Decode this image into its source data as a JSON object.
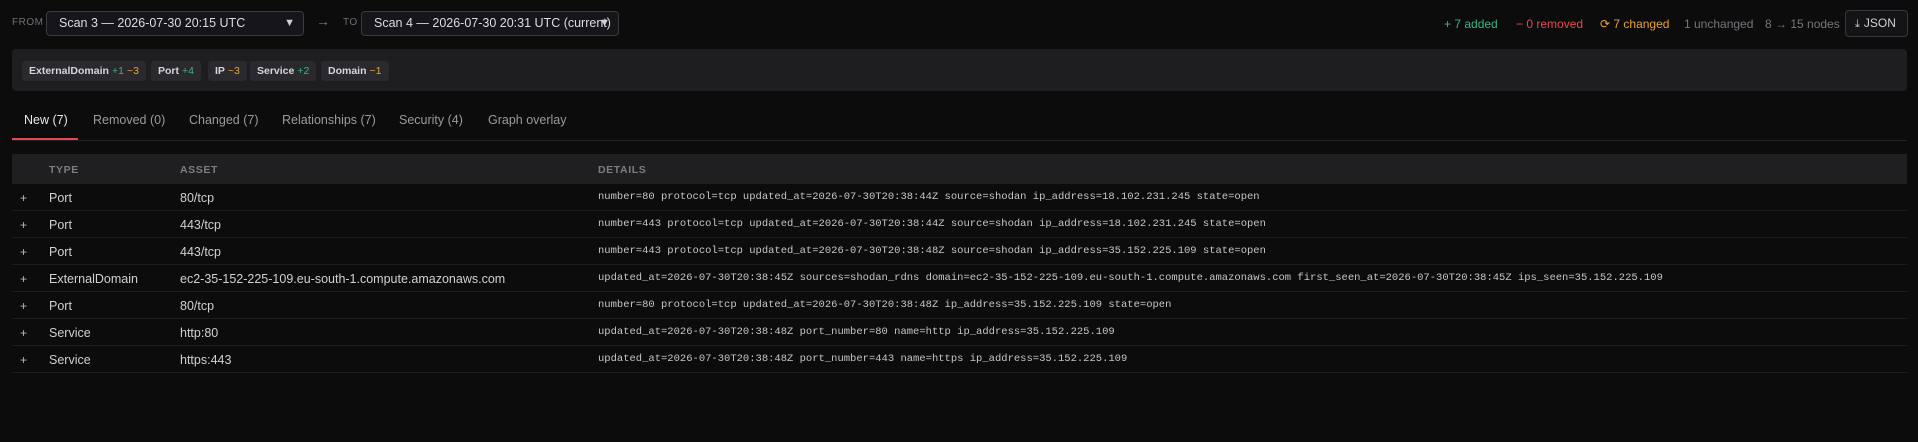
{
  "header": {
    "from_label": "FROM",
    "from_value": "Scan 3 — 2026-07-30 20:15 UTC",
    "to_label": "TO",
    "to_value": "Scan 4 — 2026-07-30 20:31 UTC (current)",
    "added": "+ 7 added",
    "removed": "− 0 removed",
    "changed": "7 changed",
    "unchanged": "1 unchanged",
    "nodes": "8 → 15 nodes",
    "json_label": "JSON"
  },
  "chips": [
    {
      "name": "ExternalDomain",
      "added": "+1",
      "changed": "~3"
    },
    {
      "name": "Port",
      "added": "+4",
      "changed": ""
    },
    {
      "name": "IP",
      "added": "",
      "changed": "~3"
    },
    {
      "name": "Service",
      "added": "+2",
      "changed": ""
    },
    {
      "name": "Domain",
      "added": "",
      "changed": "~1"
    }
  ],
  "tabs": [
    "New (7)",
    "Removed (0)",
    "Changed (7)",
    "Relationships (7)",
    "Security (4)",
    "Graph overlay"
  ],
  "table": {
    "columns": [
      "TYPE",
      "ASSET",
      "DETAILS"
    ],
    "rows": [
      {
        "mark": "+",
        "type": "Port",
        "asset": "80/tcp",
        "details": "number=80 protocol=tcp updated_at=2026-07-30T20:38:44Z source=shodan ip_address=18.102.231.245 state=open"
      },
      {
        "mark": "+",
        "type": "Port",
        "asset": "443/tcp",
        "details": "number=443 protocol=tcp updated_at=2026-07-30T20:38:44Z source=shodan ip_address=18.102.231.245 state=open"
      },
      {
        "mark": "+",
        "type": "Port",
        "asset": "443/tcp",
        "details": "number=443 protocol=tcp updated_at=2026-07-30T20:38:48Z source=shodan ip_address=35.152.225.109 state=open"
      },
      {
        "mark": "+",
        "type": "ExternalDomain",
        "asset": "ec2-35-152-225-109.eu-south-1.compute.amazonaws.com",
        "details": "updated_at=2026-07-30T20:38:45Z sources=shodan_rdns domain=ec2-35-152-225-109.eu-south-1.compute.amazonaws.com first_seen_at=2026-07-30T20:38:45Z ips_seen=35.152.225.109"
      },
      {
        "mark": "+",
        "type": "Port",
        "asset": "80/tcp",
        "details": "number=80 protocol=tcp updated_at=2026-07-30T20:38:48Z ip_address=35.152.225.109 state=open"
      },
      {
        "mark": "+",
        "type": "Service",
        "asset": "http:80",
        "details": "updated_at=2026-07-30T20:38:48Z port_number=80 name=http ip_address=35.152.225.109"
      },
      {
        "mark": "+",
        "type": "Service",
        "asset": "https:443",
        "details": "updated_at=2026-07-30T20:38:48Z port_number=443 name=https ip_address=35.152.225.109"
      }
    ]
  }
}
